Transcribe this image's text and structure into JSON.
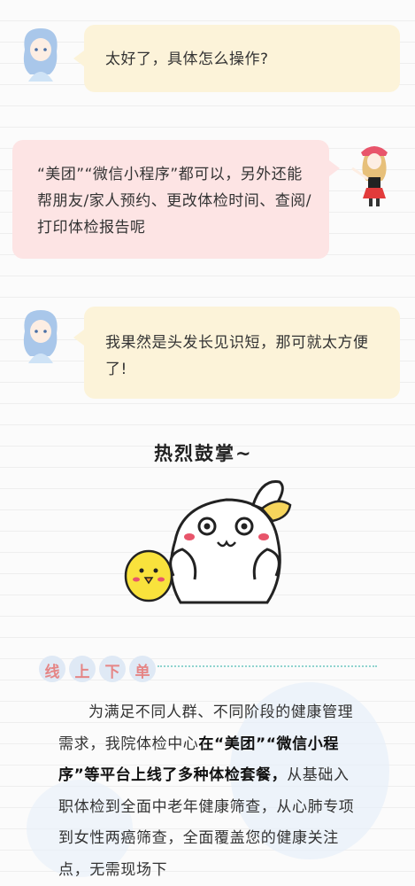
{
  "chat": {
    "msg1": "太好了，具体怎么操作?",
    "msg2": "“美团”“微信小程序”都可以，另外还能帮朋友/家人预约、更改体检时间、查阅/打印体检报告呢",
    "msg3": "我果然是头发长见识短，那可就太方便了!"
  },
  "sticker": {
    "caption": "热烈鼓掌~"
  },
  "section": {
    "title_chars": [
      "线",
      "上",
      "下",
      "单"
    ],
    "p1_a": "为满足不同人群、不同阶段的健康管理需求，我院体检中心",
    "p1_b": "在“美团”“微信小程序”等平台上线了多种体检套餐，",
    "p1_c": "从基础入职体检到全面中老年健康筛查，从心肺专项到女性两癌筛查，全面覆盖您的健康关注点，无需现场下"
  },
  "colors": {
    "yellow_bubble": "#fcf3d9",
    "pink_bubble": "#fde4e4",
    "accent_red": "#e58585",
    "dotted_teal": "#8fd3cf"
  }
}
